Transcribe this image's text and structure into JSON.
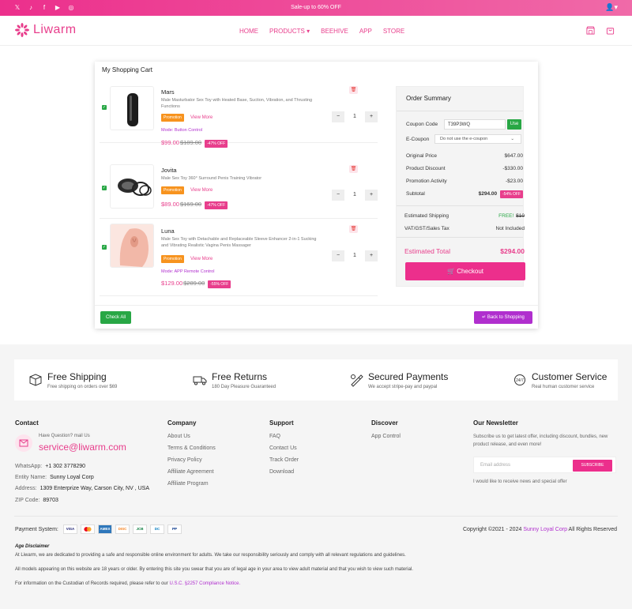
{
  "topbar": {
    "promo": "Sale-up to 60% OFF"
  },
  "brand": {
    "name": "Liwarm"
  },
  "nav": {
    "home": "HOME",
    "products": "PRODUCTS",
    "beehive": "BEEHIVE",
    "app": "APP",
    "store": "STORE"
  },
  "cart": {
    "title": "My Shopping Cart",
    "items": [
      {
        "name": "Mars",
        "desc": "Male Masturbator Sex Toy with Heated Base, Suction, Vibration, and Thrusting Functions",
        "promo": "Promotion",
        "see_more": "View More",
        "mode": "Mode: Button Control",
        "price": "$99.00",
        "old_price": "$189.00",
        "off": "-47% OFF",
        "qty": "1"
      },
      {
        "name": "Jovita",
        "desc": "Male Sex Toy 360° Surround Penis Training Vibrator",
        "promo": "Promotion",
        "see_more": "View More",
        "mode": "",
        "price": "$89.00",
        "old_price": "$169.00",
        "off": "-47% OFF",
        "qty": "1"
      },
      {
        "name": "Luna",
        "desc": "Male Sex Toy with Detachable and Replaceable Sleeve Enhancer 2-in-1 Sucking and Vibrating Realistic Vagina Penis Massager",
        "promo": "Promotion",
        "see_more": "View More",
        "mode": "Mode: APP Remote Control",
        "price": "$129.00",
        "old_price": "$289.00",
        "off": "-55% OFF",
        "qty": "1"
      }
    ],
    "check_all": "Check All",
    "back": "Back to Shopping"
  },
  "summary": {
    "title": "Order Summary",
    "coupon_label": "Coupon Code",
    "coupon_value": "T39P3WQ",
    "use": "Use",
    "ecoupon_label": "E-Coupon",
    "ecoupon_placeholder": "Do not use the e-coupon",
    "original_label": "Original Price",
    "original": "$647.00",
    "discount_label": "Product Discount",
    "discount": "-$330.00",
    "promo_label": "Promotion Activity",
    "promo": "-$23.00",
    "subtotal_label": "Subtotal",
    "subtotal": "$294.00",
    "subtotal_off": "-54% OFF",
    "shipping_label": "Estimated Shipping",
    "shipping": "FREE!",
    "shipping_old": "$10",
    "vat_label": "VAT/GST/Sales Tax",
    "vat": "Not Included",
    "total_label": "Estimated Total",
    "total": "$294.00",
    "checkout": "Checkout"
  },
  "features": [
    {
      "title": "Free Shipping",
      "sub": "Free shipping on orders over $69"
    },
    {
      "title": "Free Returns",
      "sub": "180 Day Pleasure Guaranteed"
    },
    {
      "title": "Secured Payments",
      "sub": "We accept stripe-pay and paypal"
    },
    {
      "title": "Customer Service",
      "sub": "Real human customer service"
    }
  ],
  "footer": {
    "contact": {
      "title": "Contact",
      "question": "Have Question? mail Us",
      "email": "service@liwarm.com",
      "whatsapp_label": "WhatsApp:",
      "whatsapp": "+1 302 3778290",
      "entity_label": "Entity Name:",
      "entity": "Sunny Loyal Corp",
      "address_label": "Address:",
      "address": "1309 Enterprize Way, Carson City, NV , USA",
      "zip_label": "ZIP Code:",
      "zip": "89703"
    },
    "company": {
      "title": "Company",
      "links": [
        "About Us",
        "Terms & Conditions",
        "Privacy Policy",
        "Affiliate Agreement",
        "Affiliate Program"
      ]
    },
    "support": {
      "title": "Support",
      "links": [
        "FAQ",
        "Contact Us",
        "Track Order",
        "Download"
      ]
    },
    "discover": {
      "title": "Discover",
      "links": [
        "App Control"
      ]
    },
    "newsletter": {
      "title": "Our Newsletter",
      "text": "Subscribe us to get latest offer, including discount, bundles, new product release, and even more!",
      "placeholder": "Email address",
      "button": "SUBSCRIBE",
      "note": "I would like to receive news and special offer"
    },
    "payment_label": "Payment System:",
    "payments": [
      "VISA",
      "MC",
      "AMEX",
      "DISC",
      "JCB",
      "DC",
      "PP"
    ],
    "copyright_pre": "Copyright ©2021 - 2024 ",
    "copyright_brand": "Sunny Loyal Corp",
    "copyright_post": " All Rights Reserved",
    "disclaimer_title": "Age Disclaimer",
    "disclaimer_1": "At Liwarm, we are dedicated to providing a safe and responsible online environment for adults. We take our responsibility seriously and comply with all relevant regulations and guidelines.",
    "disclaimer_2": "All models appearing on this website are 18 years or older. By entering this site you swear that you are of legal age in your area to view adult material and that you wish to view such material.",
    "disclaimer_3_pre": "For information on the Custodian of Records required, please refer to our ",
    "disclaimer_3_link": "U.S.C. §2257 Compliance Notice."
  }
}
